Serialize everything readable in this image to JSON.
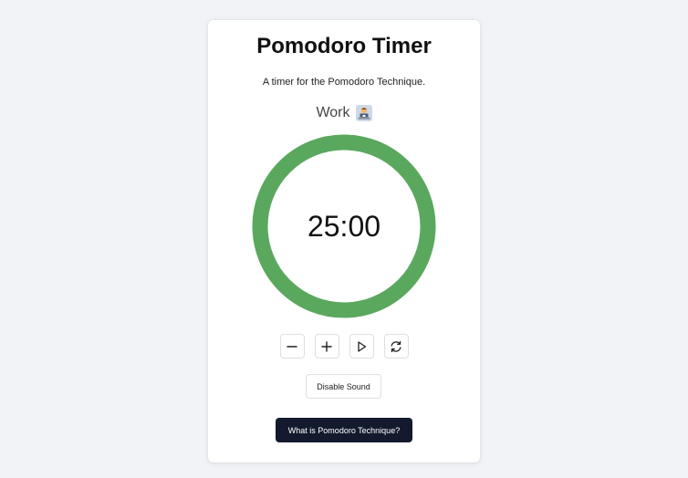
{
  "app": {
    "title": "Pomodoro Timer",
    "subtitle": "A timer for the Pomodoro Technique."
  },
  "mode": {
    "label": "Work",
    "icon": "person-at-laptop-icon"
  },
  "timer": {
    "display": "25:00",
    "progress": 1.0,
    "ring_color": "#5aa85d"
  },
  "controls": {
    "decrease_icon": "minus-icon",
    "increase_icon": "plus-icon",
    "start_icon": "play-icon",
    "reset_icon": "refresh-icon"
  },
  "sound_button": {
    "label": "Disable Sound"
  },
  "info_button": {
    "label": "What is Pomodoro Technique?"
  },
  "colors": {
    "background": "#f1f3f7",
    "card": "#ffffff",
    "dark_button": "#141a2e",
    "border": "#dcdfe4"
  }
}
